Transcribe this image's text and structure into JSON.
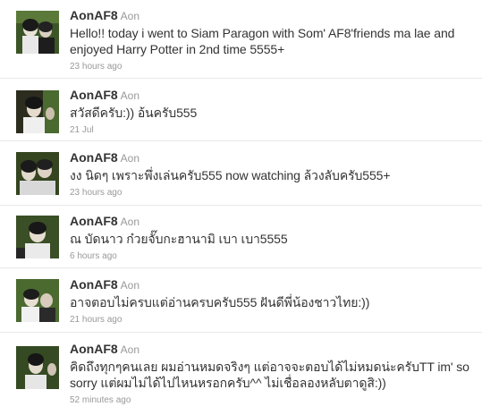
{
  "tweets": [
    {
      "screen_name": "AonAF8",
      "full_name": "Aon",
      "text": "Hello!! today i went to Siam Paragon with Som' AF8'friends ma lae and enjoyed Harry Potter in 2nd time 5555+",
      "time": "23 hours ago",
      "avatar_icon": "user-avatar-photo"
    },
    {
      "screen_name": "AonAF8",
      "full_name": "Aon",
      "text": "สวัสดีครับ:)) อ้นครับ555",
      "time": "21 Jul",
      "avatar_icon": "user-avatar-photo"
    },
    {
      "screen_name": "AonAF8",
      "full_name": "Aon",
      "text": "งง นิดๆ เพราะพึ่งเล่นครับ555 now watching ล้วงลับครับ555+",
      "time": "23 hours ago",
      "avatar_icon": "user-avatar-photo"
    },
    {
      "screen_name": "AonAF8",
      "full_name": "Aon",
      "text": "ณ บัดนาว ก๋วยจั๊บกะฮานามิ เบา เบา5555",
      "time": "6 hours ago",
      "avatar_icon": "user-avatar-photo"
    },
    {
      "screen_name": "AonAF8",
      "full_name": "Aon",
      "text": "อาจตอบไม่ครบแต่อ่านครบครับ555 ฝันดีพี่น้องชาวไทย:))",
      "time": "21 hours ago",
      "avatar_icon": "user-avatar-photo"
    },
    {
      "screen_name": "AonAF8",
      "full_name": "Aon",
      "text": "คิดถึงทุกๆคนเลย ผมอ่านหมดจริงๆ แต่อาจจะตอบได้ไม่หมดน่ะครับTT im' so sorry แต่ผมไม่ได้ไปไหนหรอกครับ^^ ไม่เชื่อลองหลับตาดูสิ:))",
      "time": "52 minutes ago",
      "avatar_icon": "user-avatar-photo"
    }
  ],
  "colors": {
    "text": "#333333",
    "meta": "#999999",
    "divider": "#e8e8e8"
  }
}
